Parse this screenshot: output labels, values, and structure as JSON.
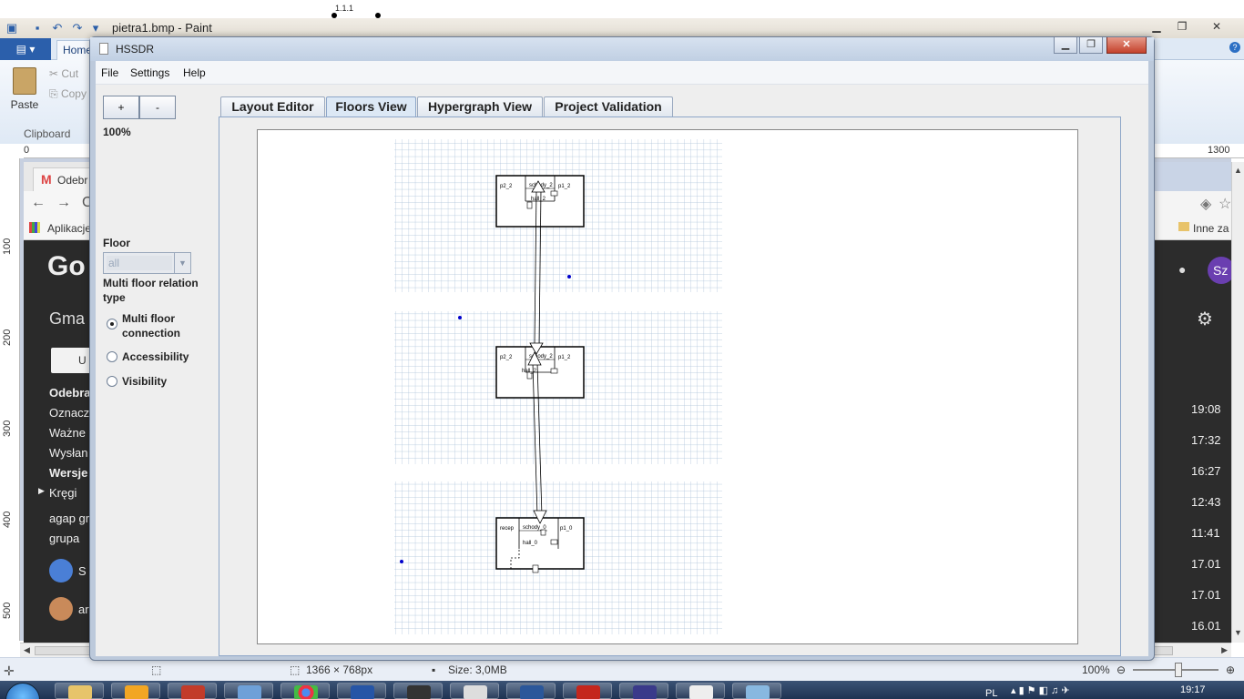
{
  "background_paint": {
    "title": "pietra1.bmp - Paint",
    "top_label": "1.1.1",
    "file_tab": "▤ ▾",
    "home_tab": "Home",
    "paste_label": "Paste",
    "cut_label": "Cut",
    "copy_label": "Copy",
    "clipboard_group": "Clipboard",
    "ruler_h": [
      "0",
      "1300"
    ],
    "ruler_v": [
      "100",
      "200",
      "300",
      "400",
      "500"
    ],
    "status_dimensions": "1366 × 768px",
    "status_size": "Size: 3,0MB",
    "status_zoom": "100%"
  },
  "background_chrome": {
    "tab_title": "Odebr",
    "bookmarks_label": "Aplikacje",
    "bookmarks_right": "Inne za",
    "gmail_logo": "Go",
    "gmail_label": "Gma",
    "compose_label": "U",
    "folders": [
      "Odebra",
      "Oznacz",
      "Ważne",
      "Wysłan",
      "Wersje",
      "Kręgi",
      "agap gr",
      "grupa"
    ],
    "account_initial": "Sz",
    "contact_1": "S",
    "contact_2": "ar",
    "times": [
      "19:08",
      "17:32",
      "16:27",
      "12:43",
      "11:41",
      "17.01",
      "17.01",
      "16.01"
    ]
  },
  "taskbar": {
    "lang": "PL",
    "time": "19:17"
  },
  "hssdr": {
    "title": "HSSDR",
    "menu": [
      "File",
      "Settings",
      "Help"
    ],
    "zoom_in_label": "+",
    "zoom_out_label": "-",
    "zoom_level": "100%",
    "floor_label": "Floor",
    "floor_value": "all",
    "relation_label": "Multi floor relation type",
    "relation_options": [
      {
        "label": "Multi floor connection",
        "selected": true
      },
      {
        "label": "Accessibility",
        "selected": false
      },
      {
        "label": "Visibility",
        "selected": false
      }
    ],
    "tabs": [
      "Layout Editor",
      "Floors View",
      "Hypergraph View",
      "Project Validation"
    ],
    "active_tab": "Floors View",
    "floors": [
      {
        "rooms": [
          "p2_2",
          "schody_2",
          "p1_2"
        ],
        "hall": "hall_2"
      },
      {
        "rooms": [
          "p2_2",
          "schody_2",
          "p1_2"
        ],
        "hall": "hall_2"
      },
      {
        "rooms": [
          "recep",
          "schody_0",
          "p1_0"
        ],
        "hall": "hall_0"
      }
    ],
    "grid_color": "#a9bfd8",
    "marker_color": "#0000cc"
  }
}
